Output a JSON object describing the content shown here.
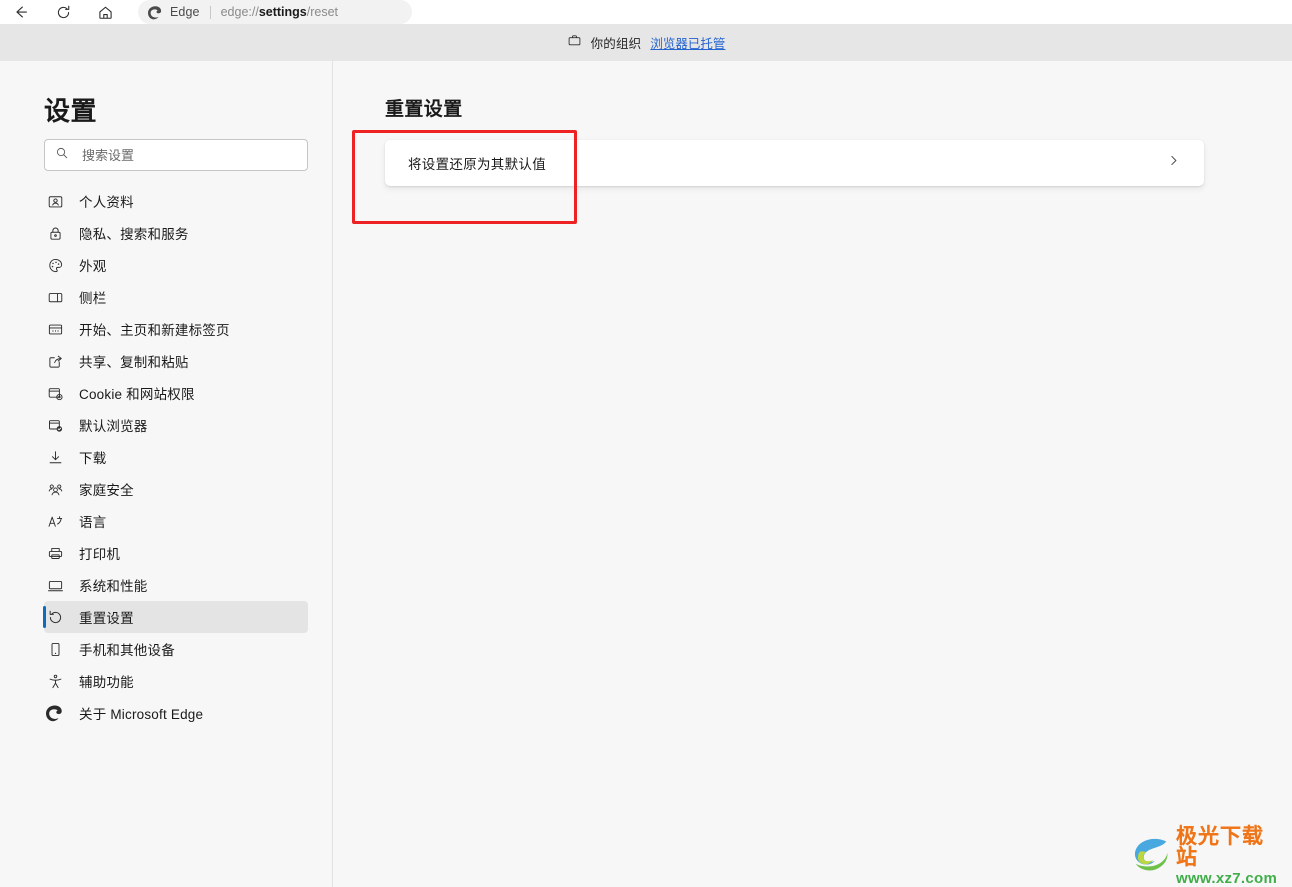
{
  "browser": {
    "back_icon": "back-arrow-icon",
    "reload_icon": "reload-icon",
    "home_icon": "home-icon",
    "brand": "Edge",
    "url_scheme": "edge://",
    "url_host": "settings",
    "url_path": "/reset"
  },
  "banner": {
    "icon": "briefcase-icon",
    "text": "你的组织",
    "link": "浏览器已托管"
  },
  "sidebar": {
    "title": "设置",
    "search": {
      "placeholder": "搜索设置",
      "value": "",
      "icon": "search-icon"
    },
    "items": [
      {
        "label": "个人资料",
        "icon": "profile-icon",
        "selected": false
      },
      {
        "label": "隐私、搜索和服务",
        "icon": "lock-icon",
        "selected": false
      },
      {
        "label": "外观",
        "icon": "palette-icon",
        "selected": false
      },
      {
        "label": "侧栏",
        "icon": "sidebar-icon",
        "selected": false
      },
      {
        "label": "开始、主页和新建标签页",
        "icon": "window-icon",
        "selected": false
      },
      {
        "label": "共享、复制和粘贴",
        "icon": "share-icon",
        "selected": false
      },
      {
        "label": "Cookie 和网站权限",
        "icon": "cookie-permissions-icon",
        "selected": false
      },
      {
        "label": "默认浏览器",
        "icon": "default-browser-icon",
        "selected": false
      },
      {
        "label": "下载",
        "icon": "download-icon",
        "selected": false
      },
      {
        "label": "家庭安全",
        "icon": "family-icon",
        "selected": false
      },
      {
        "label": "语言",
        "icon": "language-icon",
        "selected": false
      },
      {
        "label": "打印机",
        "icon": "printer-icon",
        "selected": false
      },
      {
        "label": "系统和性能",
        "icon": "system-icon",
        "selected": false
      },
      {
        "label": "重置设置",
        "icon": "reset-icon",
        "selected": true
      },
      {
        "label": "手机和其他设备",
        "icon": "phone-icon",
        "selected": false
      },
      {
        "label": "辅助功能",
        "icon": "accessibility-icon",
        "selected": false
      },
      {
        "label": "关于 Microsoft Edge",
        "icon": "edge-logo-icon",
        "selected": false
      }
    ]
  },
  "main": {
    "title": "重置设置",
    "card": {
      "label": "将设置还原为其默认值",
      "chevron_icon": "chevron-right-icon"
    }
  },
  "annotation": {
    "color": "#ee2222",
    "shape": "rectangle"
  },
  "watermark": {
    "name": "极光下载站",
    "url": "www.xz7.com",
    "logo_icon": "swirl-logo-icon"
  }
}
